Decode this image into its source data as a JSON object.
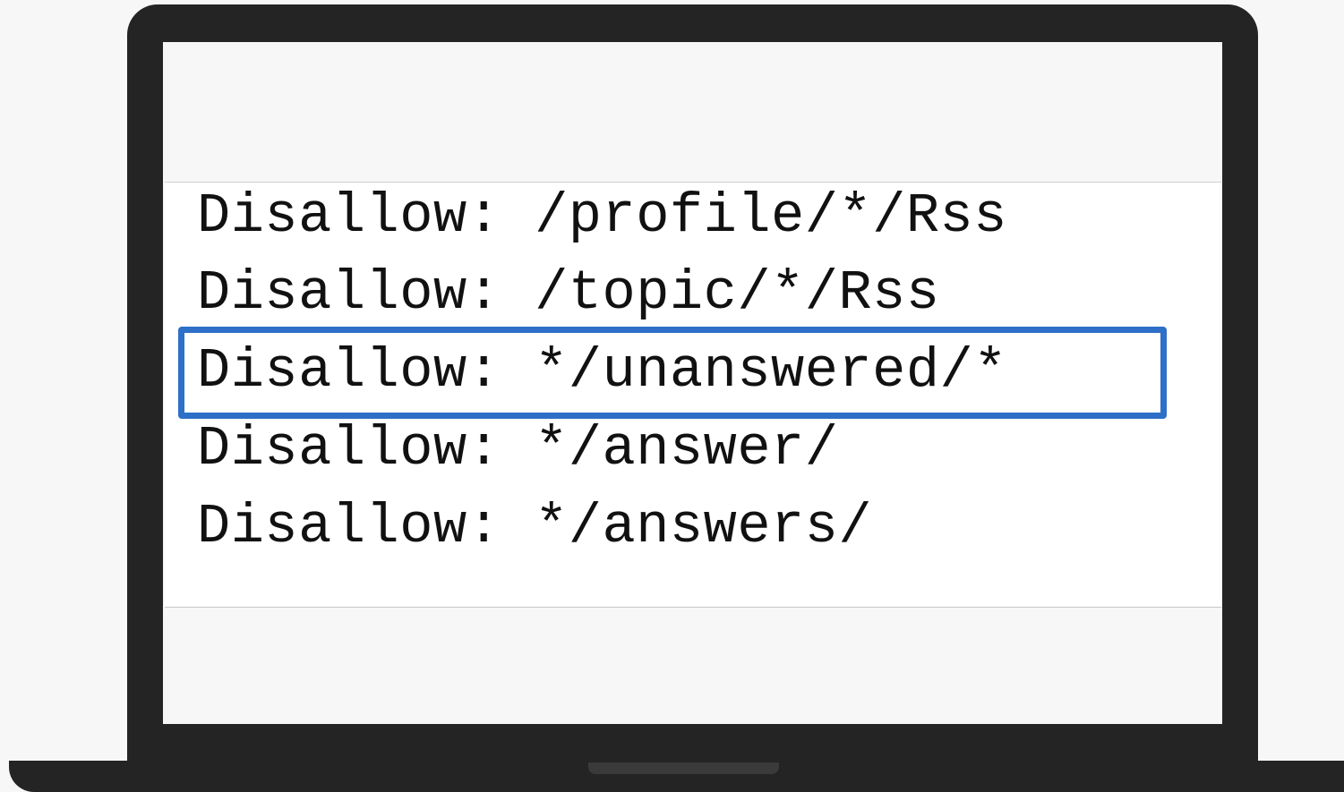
{
  "robots_lines": [
    {
      "directive": "Disallow:",
      "path": "/profile/*/Rss",
      "highlighted": false
    },
    {
      "directive": "Disallow:",
      "path": "/topic/*/Rss",
      "highlighted": false
    },
    {
      "directive": "Disallow:",
      "path": "*/unanswered/*",
      "highlighted": true
    },
    {
      "directive": "Disallow:",
      "path": "*/answer/",
      "highlighted": false
    },
    {
      "directive": "Disallow:",
      "path": "*/answers/",
      "highlighted": false
    }
  ],
  "colors": {
    "highlight_border": "#2e6fc7",
    "laptop_frame": "#242424",
    "background": "#f7f7f7",
    "code_text": "#111111"
  }
}
